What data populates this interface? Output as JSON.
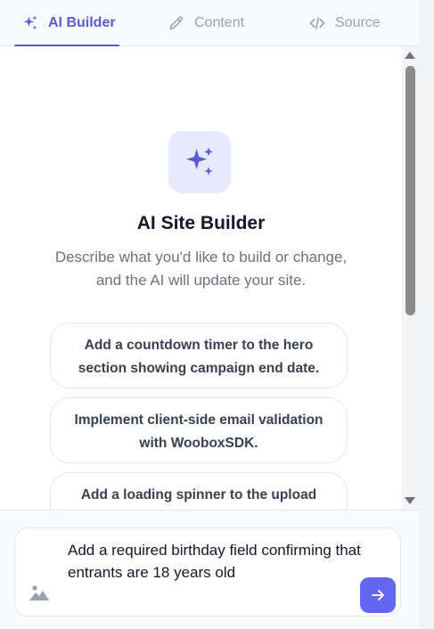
{
  "tabs": [
    {
      "label": "AI Builder",
      "icon": "sparkles-icon",
      "active": true
    },
    {
      "label": "Content",
      "icon": "pencil-icon",
      "active": false
    },
    {
      "label": "Source",
      "icon": "code-icon",
      "active": false
    }
  ],
  "hero": {
    "icon": "sparkles-icon",
    "title": "AI Site Builder",
    "subtitle": "Describe what you'd like to build or change, and the AI will update your site."
  },
  "suggestions": [
    {
      "label": "Add a countdown timer to the hero section showing campaign end date."
    },
    {
      "label": "Implement client-side email validation with WooboxSDK."
    },
    {
      "label": "Add a loading spinner to the upload"
    }
  ],
  "composer": {
    "value": "Add a required birthday field confirming that entrants are 18 years old",
    "attach_icon": "image-icon",
    "send_icon": "arrow-right-icon"
  },
  "colors": {
    "accent": "#5b5bd6",
    "send_button": "#6366f1",
    "icon_bg": "#e7e9fd"
  }
}
